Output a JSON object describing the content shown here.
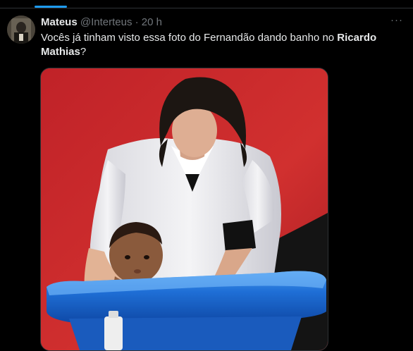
{
  "tweet": {
    "display_name": "Mateus",
    "handle": "@Interteus",
    "separator": "·",
    "time": "20 h",
    "more_label": "···",
    "text_prefix": "Vocês já tinham visto essa foto do Fernandão dando banho no ",
    "text_bold": "Ricardo Mathias",
    "text_suffix": "?"
  },
  "media": {
    "alt": "Homem de camisa branca dando banho em um bebê numa banheira azul, fundo vermelho"
  },
  "colors": {
    "accent": "#1d9bf0",
    "background": "#000000",
    "text": "#e7e9ea",
    "secondary": "#71767b",
    "photo_bg": "#c8262c",
    "tub": "#1f6fd6"
  }
}
